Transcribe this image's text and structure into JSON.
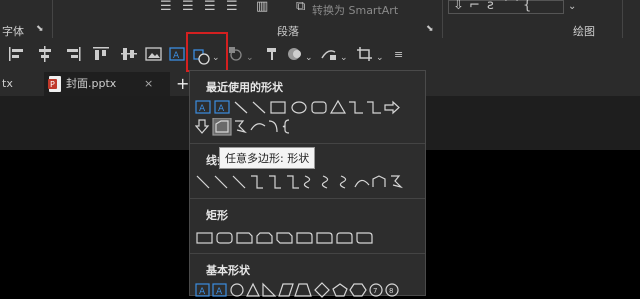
{
  "ribbon": {
    "groups": {
      "font": "字体",
      "paragraph": "段落",
      "drawing": "绘图"
    },
    "smartart_label": "转换为 SmartArt"
  },
  "tabs": [
    {
      "label": "tx"
    },
    {
      "label": "封面.pptx"
    }
  ],
  "new_tab_label": "+",
  "tab_close": "×",
  "shapes_menu": {
    "sections": [
      {
        "title": "最近使用的形状"
      },
      {
        "title": "线条"
      },
      {
        "title": "矩形"
      },
      {
        "title": "基本形状"
      }
    ],
    "tooltip": "任意多边形: 形状"
  },
  "colors": {
    "highlight_border": "#d42020",
    "panel_bg": "#2d2d2d",
    "accent_blue": "#3b8de0"
  }
}
